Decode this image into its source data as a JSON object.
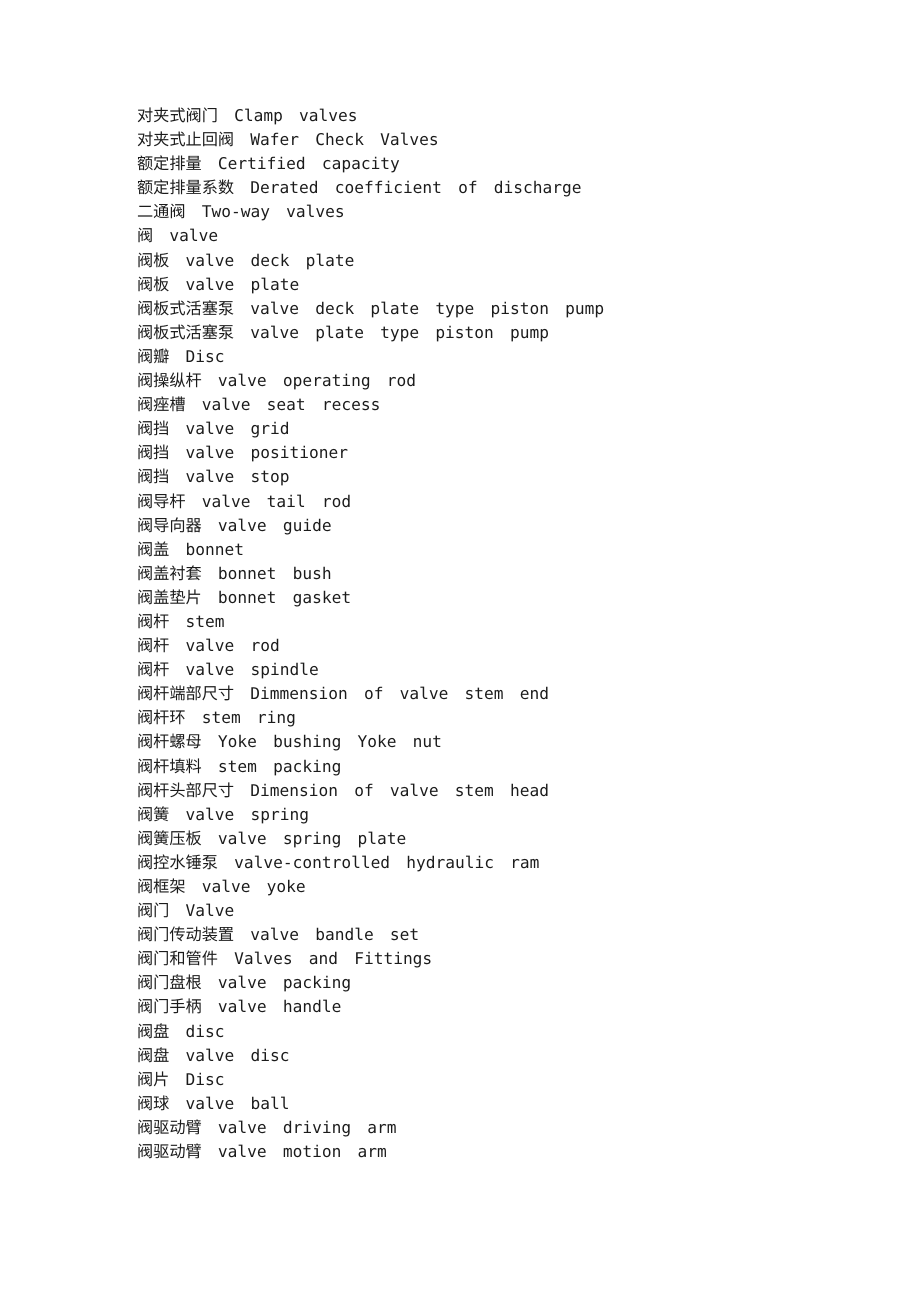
{
  "document": {
    "type": "glossary",
    "background_color": "#ffffff",
    "text_color": "#1b1b1b",
    "entries": [
      "对夹式阀门　Clamp　valves",
      "对夹式止回阀　Wafer　Check　Valves",
      "额定排量　Certified　capacity",
      "额定排量系数　Derated　coefficient　of　discharge",
      "二通阀　Two-way　valves",
      "阀　valve",
      "阀板　valve　deck　plate",
      "阀板　valve　plate",
      "阀板式活塞泵　valve　deck　plate　type　piston　pump",
      "阀板式活塞泵　valve　plate　type　piston　pump",
      "阀瓣　Disc",
      "阀操纵杆　valve　operating　rod",
      "阀痤槽　valve　seat　recess",
      "阀挡　valve　grid",
      "阀挡　valve　positioner",
      "阀挡　valve　stop",
      "阀导杆　valve　tail　rod",
      "阀导向器　valve　guide",
      "阀盖　bonnet",
      "阀盖衬套　bonnet　bush",
      "阀盖垫片　bonnet　gasket",
      "阀杆　stem",
      "阀杆　valve　rod",
      "阀杆　valve　spindle",
      "阀杆端部尺寸　Dimmension　of　valve　stem　end",
      "阀杆环　stem　ring",
      "阀杆螺母　Yoke　bushing　Yoke　nut",
      "阀杆填料　stem　packing",
      "阀杆头部尺寸　Dimension　of　valve　stem　head",
      "阀簧　valve　spring",
      "阀簧压板　valve　spring　plate",
      "阀控水锤泵　valve-controlled　hydraulic　ram",
      "阀框架　valve　yoke",
      "阀门　Valve",
      "阀门传动装置　valve　bandle　set",
      "阀门和管件　Valves　and　Fittings",
      "阀门盘根　valve　packing",
      "阀门手柄　valve　handle",
      "阀盘　disc",
      "阀盘　valve　disc",
      "阀片　Disc",
      "阀球　valve　ball",
      "阀驱动臂　valve　driving　arm",
      "阀驱动臂　valve　motion　arm"
    ]
  }
}
